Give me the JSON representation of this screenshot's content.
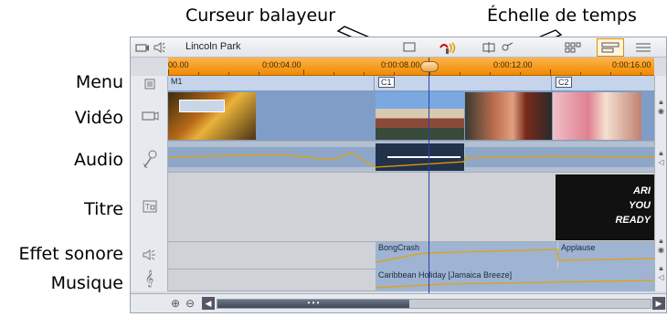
{
  "callouts": {
    "scrubber": "Curseur balayeur",
    "timescale": "Échelle de temps"
  },
  "track_labels": {
    "menu": "Menu",
    "video": "Vidéo",
    "audio": "Audio",
    "title": "Titre",
    "sfx": "Effet sonore",
    "music": "Musique"
  },
  "project": {
    "name": "Lincoln Park"
  },
  "ruler": {
    "ticks": [
      "00.00",
      "0:00:04.00",
      "0:00:08.00",
      "0:00:12.00",
      "0:00:16.00"
    ]
  },
  "menu_track": {
    "markers": [
      "M1",
      "C1",
      "C2"
    ]
  },
  "title_track": {
    "text_lines": [
      "ARI",
      "YOU",
      "READY"
    ]
  },
  "sfx_track": {
    "clips": [
      "BongCrash",
      "Applause"
    ]
  },
  "music_track": {
    "clip": "Caribbean Holiday [Jamaica Breeze]"
  },
  "colors": {
    "ruler": "#f08a00",
    "clip_blue": "#7f9dc6",
    "scrubber": "#2a3fb0",
    "lane_gray": "#c9ccd1"
  }
}
